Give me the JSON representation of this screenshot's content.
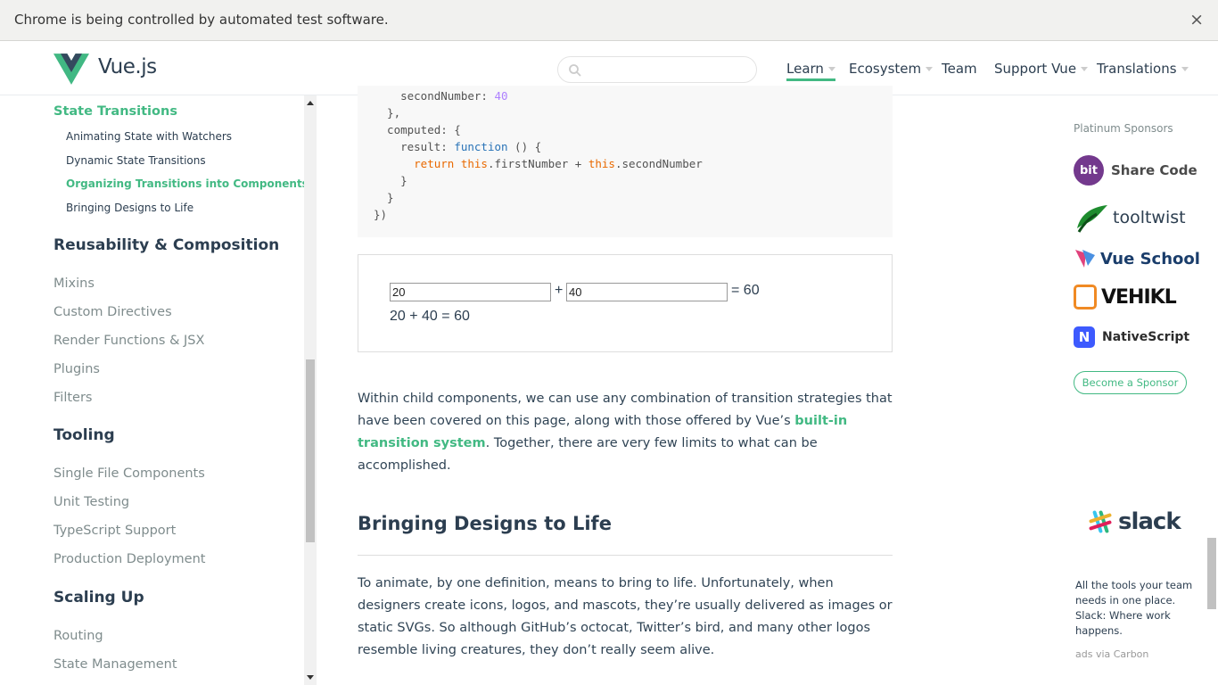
{
  "infobar": {
    "message": "Chrome is being controlled by automated test software.",
    "close": "×"
  },
  "header": {
    "brand": "Vue.js",
    "search_placeholder": "",
    "nav": [
      {
        "label": "Learn",
        "dropdown": true,
        "active": true
      },
      {
        "label": "Ecosystem",
        "dropdown": true
      },
      {
        "label": "Team",
        "dropdown": false
      },
      {
        "label": "Support Vue",
        "dropdown": true
      },
      {
        "label": "Translations",
        "dropdown": true
      }
    ]
  },
  "sidebar": {
    "current_section": "State Transitions",
    "subitems": [
      "Animating State with Watchers",
      "Dynamic State Transitions",
      "Organizing Transitions into Components",
      "Bringing Designs to Life"
    ],
    "groups": [
      {
        "title": "Reusability & Composition",
        "links": [
          "Mixins",
          "Custom Directives",
          "Render Functions & JSX",
          "Plugins",
          "Filters"
        ]
      },
      {
        "title": "Tooling",
        "links": [
          "Single File Components",
          "Unit Testing",
          "TypeScript Support",
          "Production Deployment"
        ]
      },
      {
        "title": "Scaling Up",
        "links": [
          "Routing",
          "State Management"
        ]
      }
    ]
  },
  "code_lines": [
    "    secondNumber: 40",
    "  },",
    "  computed: {",
    "    result: function () {",
    "      return this.firstNumber + this.secondNumber",
    "    }",
    "  }",
    "})"
  ],
  "demo": {
    "first": "20",
    "plus": "+",
    "second": "40",
    "result": "= 60",
    "summary": "20 + 40 = 60"
  },
  "content": {
    "para1_before": "Within child components, we can use any combination of transition strategies that have been covered on this page, along with those offered by Vue’s ",
    "para1_link": "built-in transition system",
    "para1_after": ". Together, there are very few limits to what can be accomplished.",
    "heading": "Bringing Designs to Life",
    "para2": "To animate, by one definition, means to bring to life. Unfortunately, when designers create icons, logos, and mascots, they’re usually delivered as images or static SVGs. So although GitHub’s octocat, Twitter’s bird, and many other logos resemble living creatures, they don’t really seem alive."
  },
  "sponsors": {
    "title": "Platinum Sponsors",
    "items": [
      {
        "name": "Share Code",
        "badge": "bit",
        "color": "#73398d"
      },
      {
        "name": "tooltwist",
        "color": "#2c3e50"
      },
      {
        "name": "Vue School",
        "color": "#1a3d6b"
      },
      {
        "name": "VEHIKL",
        "color": "#111111"
      },
      {
        "name": "NativeScript",
        "color": "#2c2c2c"
      }
    ],
    "become": "Become a Sponsor"
  },
  "carbon": {
    "brand": "slack",
    "text": "All the tools your team needs in one place. Slack: Where work happens.",
    "via": "ads via Carbon"
  },
  "colors": {
    "accent": "#42b983",
    "text": "#2c3e50"
  }
}
